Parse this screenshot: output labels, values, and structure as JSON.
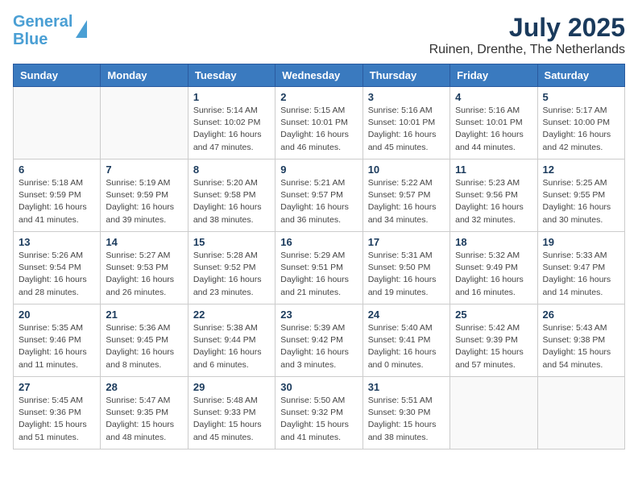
{
  "logo": {
    "line1": "General",
    "line2": "Blue"
  },
  "title": "July 2025",
  "location": "Ruinen, Drenthe, The Netherlands",
  "weekdays": [
    "Sunday",
    "Monday",
    "Tuesday",
    "Wednesday",
    "Thursday",
    "Friday",
    "Saturday"
  ],
  "weeks": [
    [
      {
        "day": "",
        "info": ""
      },
      {
        "day": "",
        "info": ""
      },
      {
        "day": "1",
        "info": "Sunrise: 5:14 AM\nSunset: 10:02 PM\nDaylight: 16 hours and 47 minutes."
      },
      {
        "day": "2",
        "info": "Sunrise: 5:15 AM\nSunset: 10:01 PM\nDaylight: 16 hours and 46 minutes."
      },
      {
        "day": "3",
        "info": "Sunrise: 5:16 AM\nSunset: 10:01 PM\nDaylight: 16 hours and 45 minutes."
      },
      {
        "day": "4",
        "info": "Sunrise: 5:16 AM\nSunset: 10:01 PM\nDaylight: 16 hours and 44 minutes."
      },
      {
        "day": "5",
        "info": "Sunrise: 5:17 AM\nSunset: 10:00 PM\nDaylight: 16 hours and 42 minutes."
      }
    ],
    [
      {
        "day": "6",
        "info": "Sunrise: 5:18 AM\nSunset: 9:59 PM\nDaylight: 16 hours and 41 minutes."
      },
      {
        "day": "7",
        "info": "Sunrise: 5:19 AM\nSunset: 9:59 PM\nDaylight: 16 hours and 39 minutes."
      },
      {
        "day": "8",
        "info": "Sunrise: 5:20 AM\nSunset: 9:58 PM\nDaylight: 16 hours and 38 minutes."
      },
      {
        "day": "9",
        "info": "Sunrise: 5:21 AM\nSunset: 9:57 PM\nDaylight: 16 hours and 36 minutes."
      },
      {
        "day": "10",
        "info": "Sunrise: 5:22 AM\nSunset: 9:57 PM\nDaylight: 16 hours and 34 minutes."
      },
      {
        "day": "11",
        "info": "Sunrise: 5:23 AM\nSunset: 9:56 PM\nDaylight: 16 hours and 32 minutes."
      },
      {
        "day": "12",
        "info": "Sunrise: 5:25 AM\nSunset: 9:55 PM\nDaylight: 16 hours and 30 minutes."
      }
    ],
    [
      {
        "day": "13",
        "info": "Sunrise: 5:26 AM\nSunset: 9:54 PM\nDaylight: 16 hours and 28 minutes."
      },
      {
        "day": "14",
        "info": "Sunrise: 5:27 AM\nSunset: 9:53 PM\nDaylight: 16 hours and 26 minutes."
      },
      {
        "day": "15",
        "info": "Sunrise: 5:28 AM\nSunset: 9:52 PM\nDaylight: 16 hours and 23 minutes."
      },
      {
        "day": "16",
        "info": "Sunrise: 5:29 AM\nSunset: 9:51 PM\nDaylight: 16 hours and 21 minutes."
      },
      {
        "day": "17",
        "info": "Sunrise: 5:31 AM\nSunset: 9:50 PM\nDaylight: 16 hours and 19 minutes."
      },
      {
        "day": "18",
        "info": "Sunrise: 5:32 AM\nSunset: 9:49 PM\nDaylight: 16 hours and 16 minutes."
      },
      {
        "day": "19",
        "info": "Sunrise: 5:33 AM\nSunset: 9:47 PM\nDaylight: 16 hours and 14 minutes."
      }
    ],
    [
      {
        "day": "20",
        "info": "Sunrise: 5:35 AM\nSunset: 9:46 PM\nDaylight: 16 hours and 11 minutes."
      },
      {
        "day": "21",
        "info": "Sunrise: 5:36 AM\nSunset: 9:45 PM\nDaylight: 16 hours and 8 minutes."
      },
      {
        "day": "22",
        "info": "Sunrise: 5:38 AM\nSunset: 9:44 PM\nDaylight: 16 hours and 6 minutes."
      },
      {
        "day": "23",
        "info": "Sunrise: 5:39 AM\nSunset: 9:42 PM\nDaylight: 16 hours and 3 minutes."
      },
      {
        "day": "24",
        "info": "Sunrise: 5:40 AM\nSunset: 9:41 PM\nDaylight: 16 hours and 0 minutes."
      },
      {
        "day": "25",
        "info": "Sunrise: 5:42 AM\nSunset: 9:39 PM\nDaylight: 15 hours and 57 minutes."
      },
      {
        "day": "26",
        "info": "Sunrise: 5:43 AM\nSunset: 9:38 PM\nDaylight: 15 hours and 54 minutes."
      }
    ],
    [
      {
        "day": "27",
        "info": "Sunrise: 5:45 AM\nSunset: 9:36 PM\nDaylight: 15 hours and 51 minutes."
      },
      {
        "day": "28",
        "info": "Sunrise: 5:47 AM\nSunset: 9:35 PM\nDaylight: 15 hours and 48 minutes."
      },
      {
        "day": "29",
        "info": "Sunrise: 5:48 AM\nSunset: 9:33 PM\nDaylight: 15 hours and 45 minutes."
      },
      {
        "day": "30",
        "info": "Sunrise: 5:50 AM\nSunset: 9:32 PM\nDaylight: 15 hours and 41 minutes."
      },
      {
        "day": "31",
        "info": "Sunrise: 5:51 AM\nSunset: 9:30 PM\nDaylight: 15 hours and 38 minutes."
      },
      {
        "day": "",
        "info": ""
      },
      {
        "day": "",
        "info": ""
      }
    ]
  ]
}
